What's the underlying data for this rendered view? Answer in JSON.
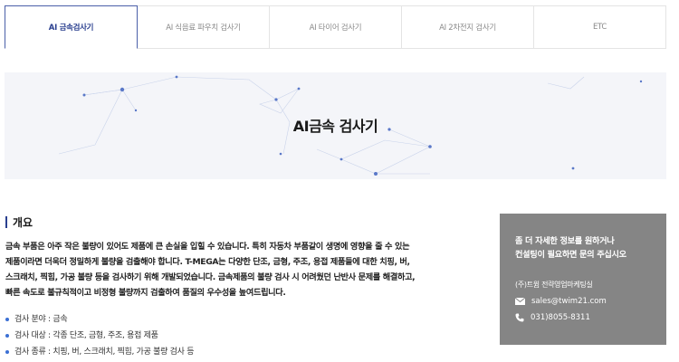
{
  "tabs": [
    {
      "label": "AI 금속검사기",
      "active": true
    },
    {
      "label": "AI 식음료 파우치 검사기",
      "active": false
    },
    {
      "label": "AI 타이어 검사기",
      "active": false
    },
    {
      "label": "AI 2차전지 검사기",
      "active": false
    },
    {
      "label": "ETC",
      "active": false
    }
  ],
  "banner": {
    "title": "AI금속 검사기"
  },
  "overview": {
    "title": "개요",
    "lines": [
      "금속 부품은 아주 작은 불량이 있어도 제품에 큰 손실을 입힐 수 있습니다. 특히 자동차 부품같이 생명에 영향을 줄 수 있는",
      "제품이라면 더욱더 정밀하게 불량을 검출해야 합니다. T-MEGA는 다양한 단조, 금형, 주조, 용접 제품들에 대한 치핑, 버,",
      "스크래치, 찍힘, 가공 불량 등을 검사하기 위해 개발되었습니다. 금속제품의 불량 검사 시 어려웠던 난반사 문제를 해결하고,",
      "빠른 속도로 불규칙적이고 비정형 불량까지 검출하여 품질의 우수성을 높여드립니다."
    ],
    "bullets": [
      "검사 분야 : 금속",
      "검사 대상 : 각종 단조, 금형, 주조, 용접 제품",
      "검사 종류 : 치핑, 버, 스크래치, 찍힘, 가공 불량 검사 등"
    ]
  },
  "contact": {
    "headline_1": "좀 더 자세한 정보를 원하거나",
    "headline_2": "컨설팅이 필요하면 문의 주십시오",
    "company": "(주)트윔 전략영업마케팅실",
    "email": "sales@twim21.com",
    "phone": "031)8055-8311",
    "bg_color": "#858585",
    "email_icon": "envelope-icon",
    "phone_icon": "phone-icon"
  },
  "colors": {
    "accent": "#2a3f8f",
    "bullet": "#3b6fd4"
  }
}
